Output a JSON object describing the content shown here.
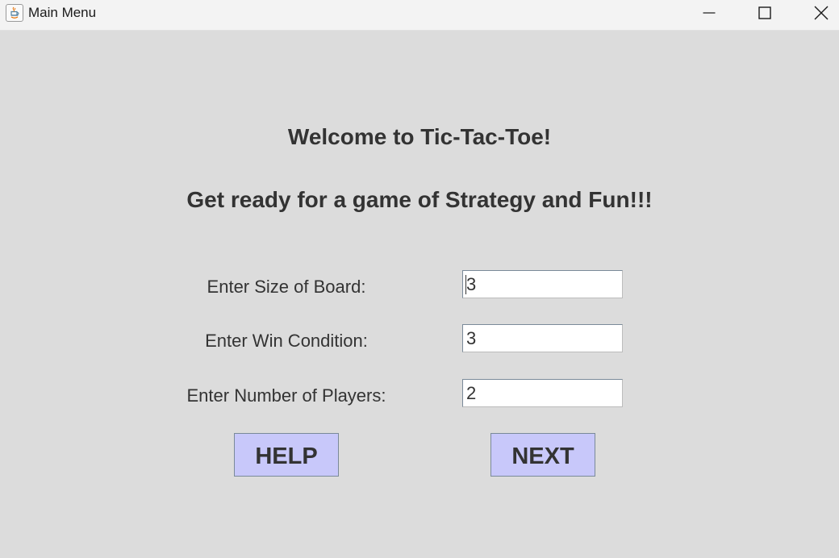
{
  "window": {
    "title": "Main Menu",
    "controls": {
      "minimize_icon": "minimize-icon",
      "maximize_icon": "maximize-icon",
      "close_icon": "close-icon"
    },
    "app_icon": "java-icon"
  },
  "main": {
    "welcome": "Welcome to Tic-Tac-Toe!",
    "tagline": "Get ready for a game of Strategy and Fun!!!",
    "fields": {
      "board_size": {
        "label": "Enter Size of Board:",
        "value": "3"
      },
      "win_condition": {
        "label": "Enter Win Condition:",
        "value": "3"
      },
      "num_players": {
        "label": "Enter Number of Players:",
        "value": "2"
      }
    },
    "buttons": {
      "help": "HELP",
      "next": "NEXT"
    }
  },
  "colors": {
    "background": "#dcdcdc",
    "titlebar": "#f3f3f3",
    "text": "#333333",
    "button_fill": "#c8c8fa",
    "button_border": "#7a8a99"
  }
}
